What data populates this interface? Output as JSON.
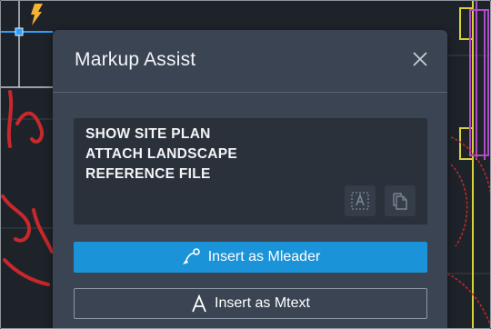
{
  "panel": {
    "title": "Markup Assist",
    "close_icon": "close-icon"
  },
  "markup": {
    "lines": [
      "SHOW SITE PLAN",
      "ATTACH LANDSCAPE",
      "REFERENCE FILE"
    ],
    "text_format_icon": "text-format-icon",
    "copy_icon": "copy-icon"
  },
  "actions": {
    "mleader_label": "Insert as Mleader",
    "mleader_icon": "mleader-icon",
    "mtext_label": "Insert as Mtext",
    "mtext_icon": "mtext-icon"
  },
  "colors": {
    "panel_bg": "#3b4453",
    "primary": "#1b93d8",
    "canvas_bg": "#1e232a",
    "markup_red": "#c8282c",
    "drawing_yellow": "#d7d23a"
  }
}
